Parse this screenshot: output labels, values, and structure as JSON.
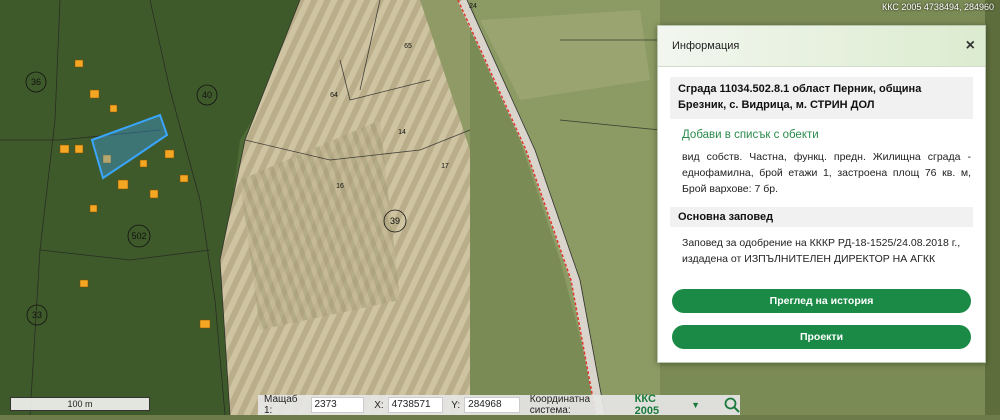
{
  "map": {
    "top_coord": "ККС 2005 4738494, 284960",
    "parcel_labels": [
      "36",
      "40",
      "502",
      "33",
      "39",
      "24",
      "64",
      "65",
      "14",
      "16",
      "17"
    ],
    "highlight_color": "#3aa6ff",
    "road_color": "#e0342a"
  },
  "panel": {
    "title": "Информация",
    "close_symbol": "×",
    "object_title": "Сграда 11034.502.8.1 област Перник, община Брезник, с. Видрица, м. СТРИН ДОЛ",
    "add_link": "Добави в списък с обекти",
    "description": "вид собств. Частна, функц. предн. Жилищна сграда - еднофамилна, брой етажи 1, застроена площ 76 кв. м, Брой вархове: 7 бр.",
    "section_title": "Основна заповед",
    "order_text": "Заповед за одобрение на КККР РД-18-1525/24.08.2018 г., издадена от ИЗПЪЛНИТЕЛЕН ДИРЕКТОР НА АГКК",
    "history_button": "Преглед на история",
    "projects_button": "Проекти",
    "accent_color": "#1a8a46"
  },
  "scale": {
    "label": "100 m"
  },
  "bottom": {
    "scale_label": "Мащаб 1:",
    "scale_value": "2373",
    "x_label": "X:",
    "x_value": "4738571",
    "y_label": "Y:",
    "y_value": "284968",
    "crs_label": "Координатна система:",
    "crs_value": "ККС 2005",
    "dropdown_icon": "chevron-down-icon",
    "search_icon": "search-icon"
  }
}
